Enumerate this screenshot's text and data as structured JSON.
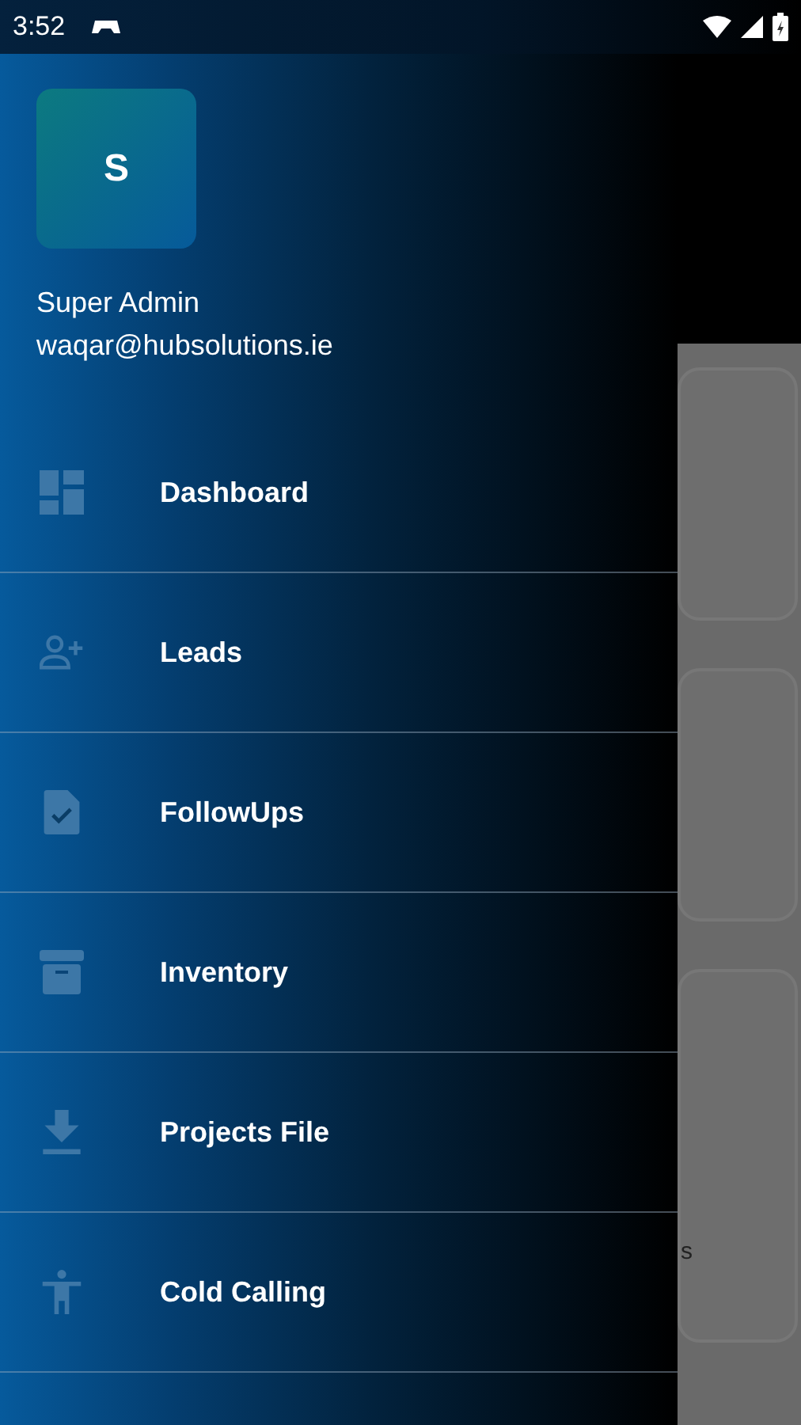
{
  "status_bar": {
    "time": "3:52"
  },
  "profile": {
    "initial": "S",
    "name": "Super Admin",
    "email": "waqar@hubsolutions.ie"
  },
  "menu": [
    {
      "label": "Dashboard"
    },
    {
      "label": "Leads"
    },
    {
      "label": "FollowUps"
    },
    {
      "label": "Inventory"
    },
    {
      "label": "Projects File"
    },
    {
      "label": "Cold Calling"
    }
  ],
  "background": {
    "fragment_text": "s"
  }
}
